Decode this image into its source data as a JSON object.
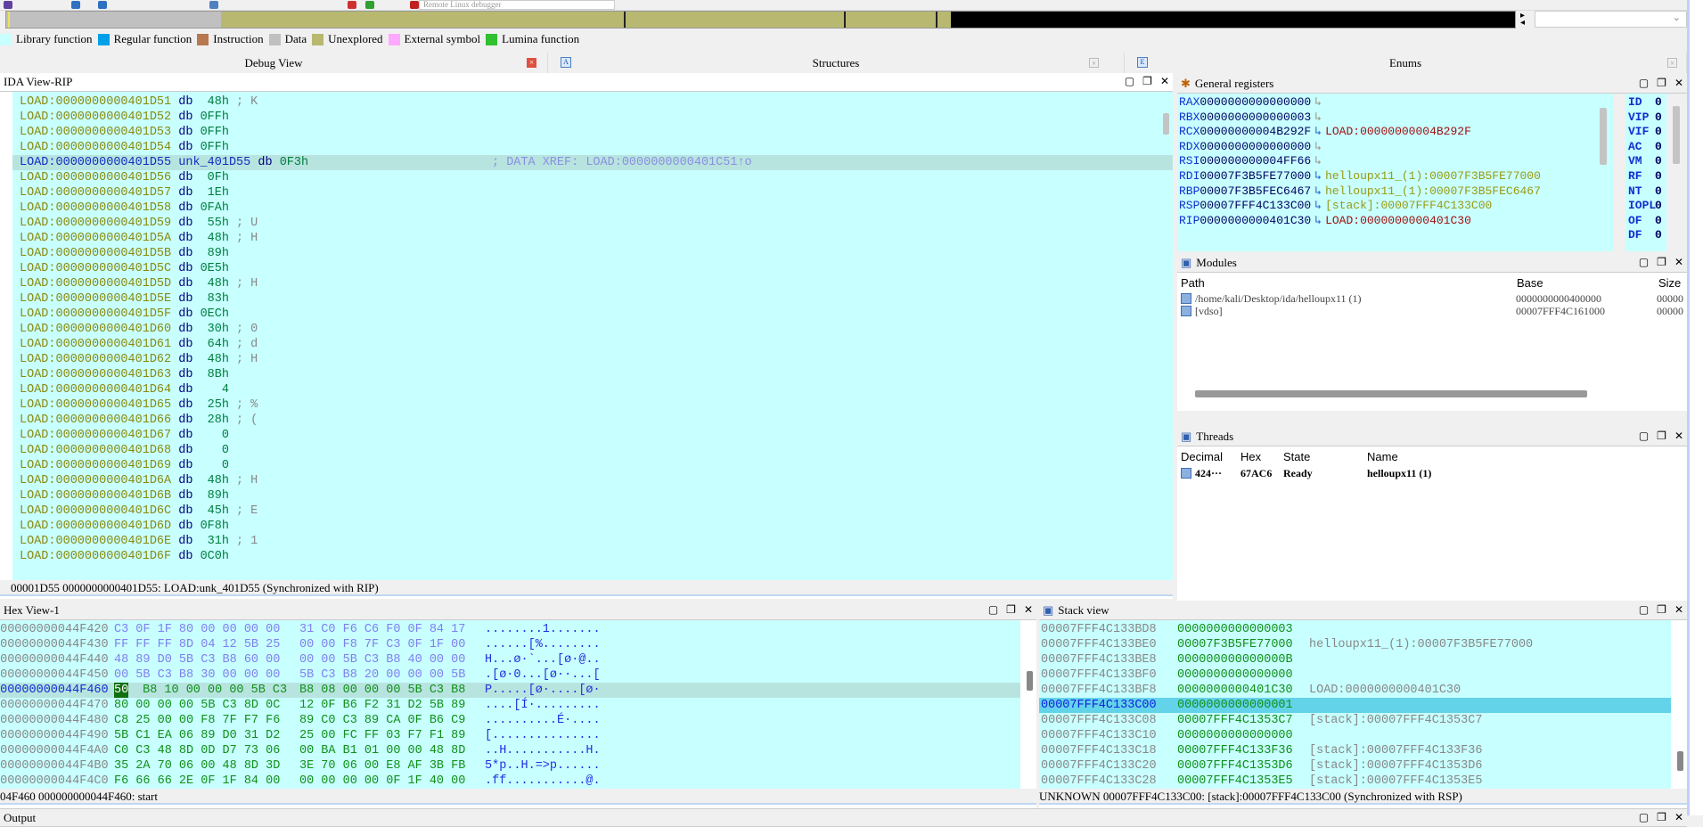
{
  "toolbar": {
    "debugger_select": "Remote Linux debugger"
  },
  "legend": [
    {
      "label": "Library function",
      "color": "#c8ffff"
    },
    {
      "label": "Regular function",
      "color": "#00a0e8"
    },
    {
      "label": "Instruction",
      "color": "#b87850"
    },
    {
      "label": "Data",
      "color": "#c0c0c0"
    },
    {
      "label": "Unexplored",
      "color": "#b8b870"
    },
    {
      "label": "External symbol",
      "color": "#ffa8ff"
    },
    {
      "label": "Lumina function",
      "color": "#30c030"
    }
  ],
  "colors": {
    "code_bg": "#c8ffff",
    "address": "#8a8a10",
    "mnemonic": "#000080",
    "operand": "#008040",
    "highlight": "#b8e4e0",
    "stack_highlight": "#63d3ea"
  },
  "tabs": [
    {
      "label": "Debug View"
    },
    {
      "label": "Structures"
    },
    {
      "label": "Enums"
    }
  ],
  "ida_view": {
    "title": "IDA View-RIP",
    "lines": [
      [
        "LOAD:0000000000401D51",
        "",
        "db",
        "48h",
        "; K"
      ],
      [
        "LOAD:0000000000401D52",
        "",
        "db",
        "0FFh",
        ""
      ],
      [
        "LOAD:0000000000401D53",
        "",
        "db",
        "0FFh",
        ""
      ],
      [
        "LOAD:0000000000401D54",
        "",
        "db",
        "0FFh",
        ""
      ],
      [
        "LOAD:0000000000401D55",
        "unk_401D55",
        "db",
        "0F3h",
        "; DATA XREF: LOAD:0000000000401C51↑o"
      ],
      [
        "LOAD:0000000000401D56",
        "",
        "db",
        "0Fh",
        ""
      ],
      [
        "LOAD:0000000000401D57",
        "",
        "db",
        "1Eh",
        ""
      ],
      [
        "LOAD:0000000000401D58",
        "",
        "db",
        "0FAh",
        ""
      ],
      [
        "LOAD:0000000000401D59",
        "",
        "db",
        "55h",
        "; U"
      ],
      [
        "LOAD:0000000000401D5A",
        "",
        "db",
        "48h",
        "; H"
      ],
      [
        "LOAD:0000000000401D5B",
        "",
        "db",
        "89h",
        ""
      ],
      [
        "LOAD:0000000000401D5C",
        "",
        "db",
        "0E5h",
        ""
      ],
      [
        "LOAD:0000000000401D5D",
        "",
        "db",
        "48h",
        "; H"
      ],
      [
        "LOAD:0000000000401D5E",
        "",
        "db",
        "83h",
        ""
      ],
      [
        "LOAD:0000000000401D5F",
        "",
        "db",
        "0ECh",
        ""
      ],
      [
        "LOAD:0000000000401D60",
        "",
        "db",
        "30h",
        "; 0"
      ],
      [
        "LOAD:0000000000401D61",
        "",
        "db",
        "64h",
        "; d"
      ],
      [
        "LOAD:0000000000401D62",
        "",
        "db",
        "48h",
        "; H"
      ],
      [
        "LOAD:0000000000401D63",
        "",
        "db",
        "8Bh",
        ""
      ],
      [
        "LOAD:0000000000401D64",
        "",
        "db",
        "4",
        ""
      ],
      [
        "LOAD:0000000000401D65",
        "",
        "db",
        "25h",
        "; %"
      ],
      [
        "LOAD:0000000000401D66",
        "",
        "db",
        "28h",
        "; ("
      ],
      [
        "LOAD:0000000000401D67",
        "",
        "db",
        "0",
        ""
      ],
      [
        "LOAD:0000000000401D68",
        "",
        "db",
        "0",
        ""
      ],
      [
        "LOAD:0000000000401D69",
        "",
        "db",
        "0",
        ""
      ],
      [
        "LOAD:0000000000401D6A",
        "",
        "db",
        "48h",
        "; H"
      ],
      [
        "LOAD:0000000000401D6B",
        "",
        "db",
        "89h",
        ""
      ],
      [
        "LOAD:0000000000401D6C",
        "",
        "db",
        "45h",
        "; E"
      ],
      [
        "LOAD:0000000000401D6D",
        "",
        "db",
        "0F8h",
        ""
      ],
      [
        "LOAD:0000000000401D6E",
        "",
        "db",
        "31h",
        "; 1"
      ],
      [
        "LOAD:0000000000401D6F",
        "",
        "db",
        "0C0h",
        ""
      ]
    ],
    "status": "00001D55 0000000000401D55: LOAD:unk_401D55 (Synchronized with RIP)"
  },
  "registers": {
    "title": "General registers",
    "regs": [
      [
        "RAX",
        "0000000000000000",
        ""
      ],
      [
        "RBX",
        "0000000000000003",
        ""
      ],
      [
        "RCX",
        "00000000004B292F",
        "LOAD:00000000004B292F"
      ],
      [
        "RDX",
        "0000000000000000",
        ""
      ],
      [
        "RSI",
        "000000000004FF66",
        ""
      ],
      [
        "RDI",
        "00007F3B5FE77000",
        "helloupx11_(1):00007F3B5FE77000"
      ],
      [
        "RBP",
        "00007F3B5FEC6467",
        "helloupx11_(1):00007F3B5FEC6467"
      ],
      [
        "RSP",
        "00007FFF4C133C00",
        "[stack]:00007FFF4C133C00"
      ],
      [
        "RIP",
        "0000000000401C30",
        "LOAD:0000000000401C30"
      ]
    ],
    "flags": [
      [
        "ID",
        "0"
      ],
      [
        "VIP",
        "0"
      ],
      [
        "VIF",
        "0"
      ],
      [
        "AC",
        "0"
      ],
      [
        "VM",
        "0"
      ],
      [
        "RF",
        "0"
      ],
      [
        "NT",
        "0"
      ],
      [
        "IOPL",
        "0"
      ],
      [
        "OF",
        "0"
      ],
      [
        "DF",
        "0"
      ]
    ]
  },
  "modules": {
    "title": "Modules",
    "columns": [
      "Path",
      "Base",
      "Size"
    ],
    "rows": [
      [
        "/home/kali/Desktop/ida/helloupx11 (1)",
        "0000000000400000",
        "00000"
      ],
      [
        "[vdso]",
        "00007FFF4C161000",
        "00000"
      ]
    ]
  },
  "threads": {
    "title": "Threads",
    "columns": [
      "Decimal",
      "Hex",
      "State",
      "Name"
    ],
    "rows": [
      [
        "424···",
        "67AC6",
        "Ready",
        "helloupx11 (1)"
      ]
    ]
  },
  "hex_view": {
    "title": "Hex View-1",
    "rows": [
      [
        "000000000044F420",
        "C3 0F 1F 80 00 00 00 00",
        "31 C0 F6 C6 F0 0F 84 17",
        "........1......."
      ],
      [
        "000000000044F430",
        "FF FF FF 8D 04 12 5B 25",
        "00 00 F8 7F C3 0F 1F 00",
        "......[%........"
      ],
      [
        "000000000044F440",
        "48 89 D0 5B C3 B8 60 00",
        "00 00 5B C3 B8 40 00 00",
        "H...ø·`...[ø·@.."
      ],
      [
        "000000000044F450",
        "00 5B C3 B8 30 00 00 00",
        "5B C3 B8 20 00 00 00 5B",
        ".[ø·0...[ø··...["
      ],
      [
        "000000000044F460",
        "50 B8 10 00 00 00 5B C3",
        "B8 08 00 00 00 5B C3 B8",
        "P.....[ø·....[ø·"
      ],
      [
        "000000000044F470",
        "80 00 00 00 5B C3 8D 0C",
        "12 0F B6 F2 31 D2 5B 89",
        "....[Í·........."
      ],
      [
        "000000000044F480",
        "C8 25 00 00 F8 7F F7 F6",
        "89 C0 C3 89 CA 0F B6 C9",
        "..........É·...."
      ],
      [
        "000000000044F490",
        "5B C1 EA 06 89 D0 31 D2",
        "25 00 FC FF 03 F7 F1 89",
        "[..............."
      ],
      [
        "000000000044F4A0",
        "C0 C3 48 8D 0D D7 73 06",
        "00 BA B1 01 00 00 48 8D",
        "..H...........H."
      ],
      [
        "000000000044F4B0",
        "35 2A 70 06 00 48 8D 3D",
        "3E 70 06 00 E8 AF 3B FB",
        "5*p..H.=>p......"
      ],
      [
        "000000000044F4C0",
        "F6 66 66 2E 0F 1F 84 00",
        "00 00 00 00 0F 1F 40 00",
        ".ff...........@."
      ]
    ],
    "status": "04F460 000000000044F460: start"
  },
  "stack_view": {
    "title": "Stack view",
    "rows": [
      [
        "00007FFF4C133BD8",
        "0000000000000003",
        ""
      ],
      [
        "00007FFF4C133BE0",
        "00007F3B5FE77000",
        "helloupx11_(1):00007F3B5FE77000"
      ],
      [
        "00007FFF4C133BE8",
        "000000000000000B",
        ""
      ],
      [
        "00007FFF4C133BF0",
        "0000000000000000",
        ""
      ],
      [
        "00007FFF4C133BF8",
        "0000000000401C30",
        "LOAD:0000000000401C30"
      ],
      [
        "00007FFF4C133C00",
        "0000000000000001",
        ""
      ],
      [
        "00007FFF4C133C08",
        "00007FFF4C1353C7",
        "[stack]:00007FFF4C1353C7"
      ],
      [
        "00007FFF4C133C10",
        "0000000000000000",
        ""
      ],
      [
        "00007FFF4C133C18",
        "00007FFF4C133F36",
        "[stack]:00007FFF4C133F36"
      ],
      [
        "00007FFF4C133C20",
        "00007FFF4C1353D6",
        "[stack]:00007FFF4C1353D6"
      ],
      [
        "00007FFF4C133C28",
        "00007FFF4C1353E5",
        "[stack]:00007FFF4C1353E5"
      ]
    ],
    "status": "UNKNOWN 00007FFF4C133C00: [stack]:00007FFF4C133C00 (Synchronized with RSP)"
  },
  "output": {
    "title": "Output"
  }
}
